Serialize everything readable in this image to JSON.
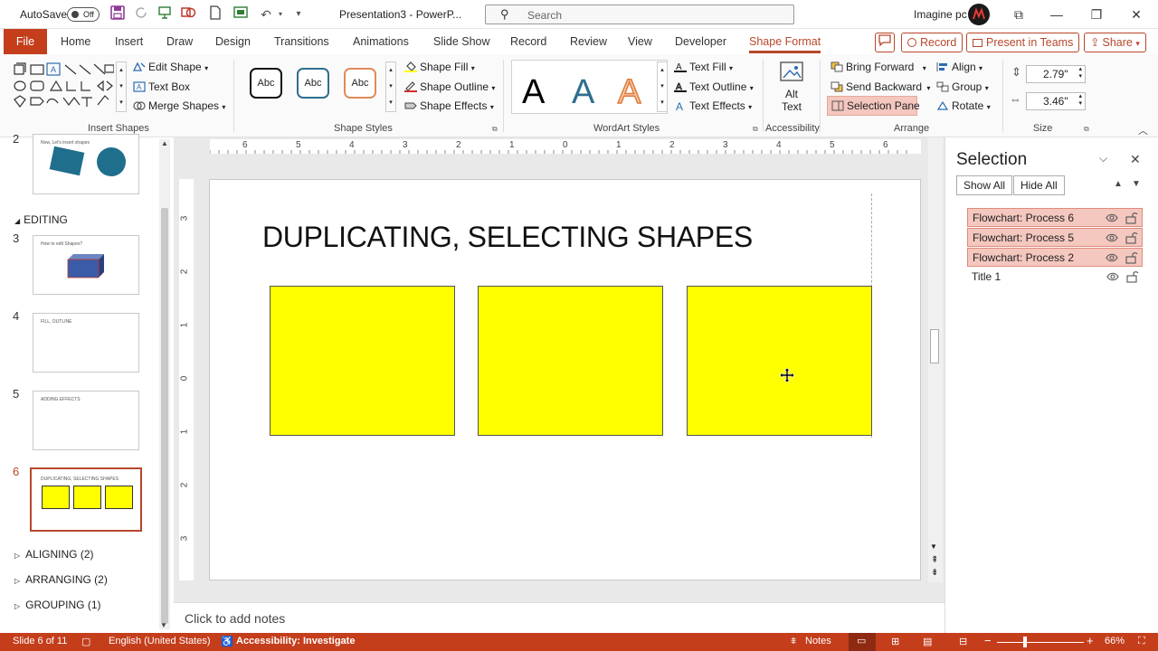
{
  "titlebar": {
    "autosave_label": "AutoSave",
    "autosave_state": "Off",
    "doc_title": "Presentation3  -  PowerP...",
    "search_placeholder": "Search",
    "user_name": "Imagine pc"
  },
  "tabs": [
    "File",
    "Home",
    "Insert",
    "Draw",
    "Design",
    "Transitions",
    "Animations",
    "Slide Show",
    "Record",
    "Review",
    "View",
    "Developer",
    "Shape Format"
  ],
  "active_tab": "Shape Format",
  "tab_buttons": {
    "record": "Record",
    "present": "Present in Teams",
    "share": "Share"
  },
  "ribbon": {
    "insert_shapes": {
      "edit_shape": "Edit Shape",
      "text_box": "Text Box",
      "merge_shapes": "Merge Shapes",
      "label": "Insert Shapes"
    },
    "shape_styles": {
      "style_text": "Abc",
      "shape_fill": "Shape Fill",
      "shape_outline": "Shape Outline",
      "shape_effects": "Shape Effects",
      "label": "Shape Styles"
    },
    "wordart": {
      "letter": "A",
      "text_fill": "Text Fill",
      "text_outline": "Text Outline",
      "text_effects": "Text Effects",
      "label": "WordArt Styles"
    },
    "accessibility": {
      "alt_text_1": "Alt",
      "alt_text_2": "Text",
      "label": "Accessibility"
    },
    "arrange": {
      "bring_forward": "Bring Forward",
      "send_backward": "Send Backward",
      "selection_pane": "Selection Pane",
      "align": "Align",
      "group": "Group",
      "rotate": "Rotate",
      "label": "Arrange"
    },
    "size": {
      "height": "2.79\"",
      "width": "3.46\"",
      "label": "Size"
    }
  },
  "thumbnails": {
    "slide2": {
      "number": "2",
      "title": "Now, Let's insert shapes"
    },
    "section_editing": "EDITING",
    "slide3": {
      "number": "3",
      "title": "How to edit Shapes?"
    },
    "slide4": {
      "number": "4",
      "title": "FILL, OUTLINE"
    },
    "slide5": {
      "number": "5",
      "title": "ADDING EFFECTS"
    },
    "slide6": {
      "number": "6",
      "title": "DUPLICATING, SELECTING SHAPES"
    },
    "sections": [
      "ALIGNING (2)",
      "ARRANGING (2)",
      "GROUPING (1)"
    ]
  },
  "ruler": {
    "h": [
      "6",
      "5",
      "4",
      "3",
      "2",
      "1",
      "0",
      "1",
      "2",
      "3",
      "4",
      "5",
      "6"
    ],
    "v": [
      "3",
      "2",
      "1",
      "0",
      "1",
      "2",
      "3"
    ]
  },
  "slide": {
    "title": "DUPLICATING, SELECTING SHAPES",
    "fill_color": "#ffff00"
  },
  "notes_placeholder": "Click to add notes",
  "selection_pane": {
    "title": "Selection",
    "show_all": "Show All",
    "hide_all": "Hide All",
    "items": [
      {
        "label": "Flowchart: Process 6",
        "selected": true
      },
      {
        "label": "Flowchart: Process 5",
        "selected": true
      },
      {
        "label": "Flowchart: Process 2",
        "selected": true
      },
      {
        "label": "Title 1",
        "selected": false
      }
    ]
  },
  "status": {
    "slide_info": "Slide 6 of 11",
    "language": "English (United States)",
    "accessibility": "Accessibility: Investigate",
    "notes": "Notes",
    "zoom": "66%"
  },
  "colors": {
    "accent": "#c43e1c",
    "selection": "#f4c7bf"
  }
}
